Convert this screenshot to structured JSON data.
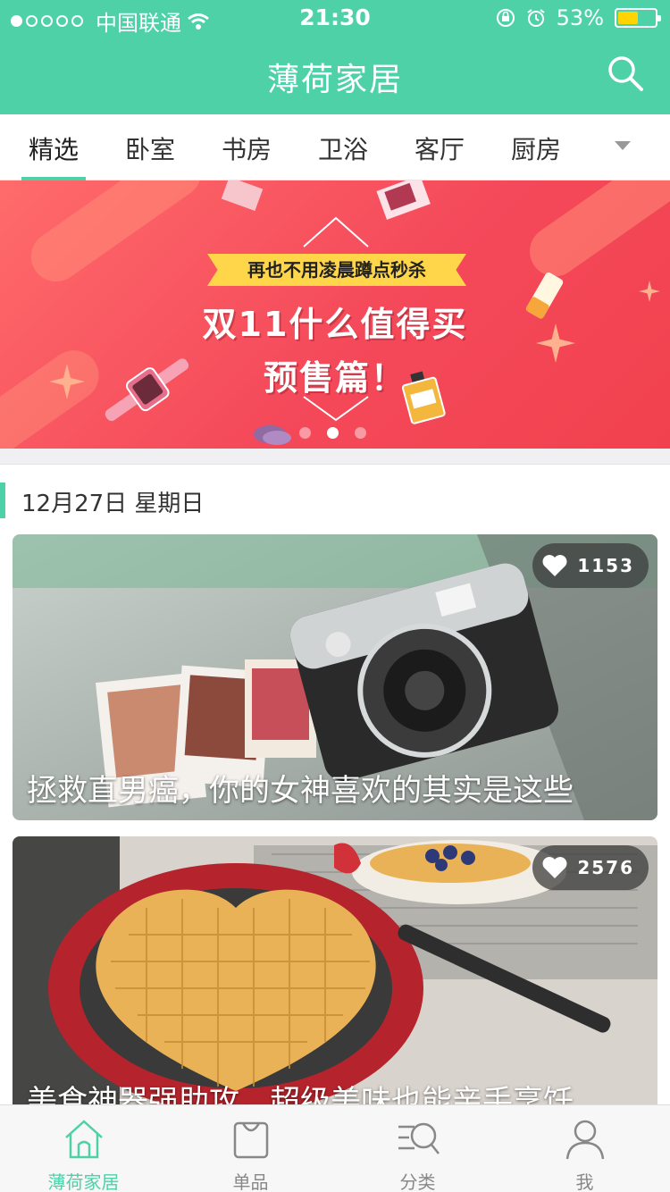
{
  "status_bar": {
    "carrier": "中国联通",
    "time": "21:30",
    "battery": "53%",
    "battery_level": 0.53
  },
  "header": {
    "title": "薄荷家居"
  },
  "tabs": [
    "精选",
    "卧室",
    "书房",
    "卫浴",
    "客厅",
    "厨房"
  ],
  "banner": {
    "tag": "再也不用凌晨蹲点秒杀",
    "line1": "双11什么值得买",
    "line2": "预售篇！",
    "pages": 3,
    "active_page": 2
  },
  "section": {
    "date": "12月27日 星期日"
  },
  "articles": [
    {
      "title": "拯救直男癌，你的女神喜欢的其实是这些",
      "likes": "1153"
    },
    {
      "title": "美食神器强助攻，超级美味也能亲手烹饪",
      "likes": "2576"
    }
  ],
  "bottom_nav": [
    "薄荷家居",
    "单品",
    "分类",
    "我"
  ],
  "colors": {
    "accent": "#4fd1a8",
    "banner_red": "#f4495a",
    "ribbon_yellow": "#ffd54a"
  }
}
